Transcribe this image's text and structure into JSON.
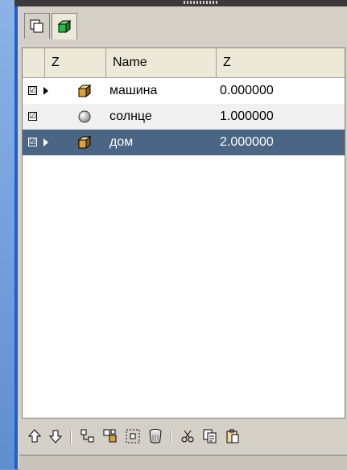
{
  "tabs": [
    {
      "icon": "layers-icon"
    },
    {
      "icon": "green-cube-icon"
    }
  ],
  "table": {
    "headers": [
      "",
      "Z",
      "Name",
      "Z"
    ],
    "rows": [
      {
        "checked": "☑",
        "expandable": true,
        "icon": "cube-icon",
        "name": "машина",
        "z": "0.000000",
        "selected": false
      },
      {
        "checked": "☑",
        "expandable": false,
        "icon": "sphere-icon",
        "name": "солнце",
        "z": "1.000000",
        "selected": false
      },
      {
        "checked": "☑",
        "expandable": true,
        "icon": "cube-icon",
        "name": "дом",
        "z": "2.000000",
        "selected": true
      }
    ]
  },
  "toolbar": [
    "move-up-icon",
    "move-down-icon",
    "group-icon",
    "ungroup-icon",
    "select-icon",
    "delete-icon",
    "cut-icon",
    "copy-icon",
    "paste-icon"
  ]
}
